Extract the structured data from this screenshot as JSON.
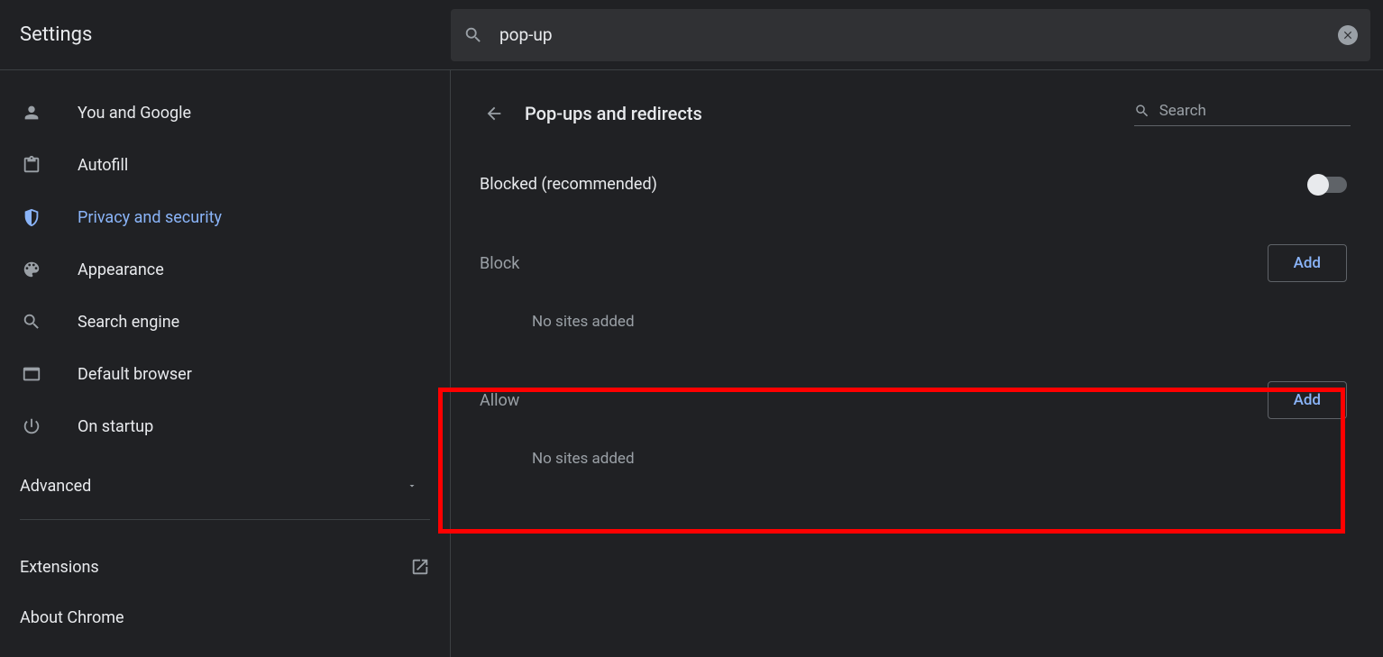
{
  "header": {
    "title": "Settings",
    "search_value": "pop-up"
  },
  "sidebar": {
    "items": [
      {
        "icon": "person",
        "label": "You and Google"
      },
      {
        "icon": "clipboard",
        "label": "Autofill"
      },
      {
        "icon": "shield",
        "label": "Privacy and security"
      },
      {
        "icon": "palette",
        "label": "Appearance"
      },
      {
        "icon": "search",
        "label": "Search engine"
      },
      {
        "icon": "browser",
        "label": "Default browser"
      },
      {
        "icon": "power",
        "label": "On startup"
      }
    ],
    "advanced": "Advanced",
    "footer": {
      "extensions": "Extensions",
      "about": "About Chrome"
    }
  },
  "content": {
    "page_title": "Pop-ups and redirects",
    "search_placeholder": "Search",
    "toggle_label": "Blocked (recommended)",
    "block_section": {
      "title": "Block",
      "add_label": "Add",
      "empty": "No sites added"
    },
    "allow_section": {
      "title": "Allow",
      "add_label": "Add",
      "empty": "No sites added"
    }
  }
}
